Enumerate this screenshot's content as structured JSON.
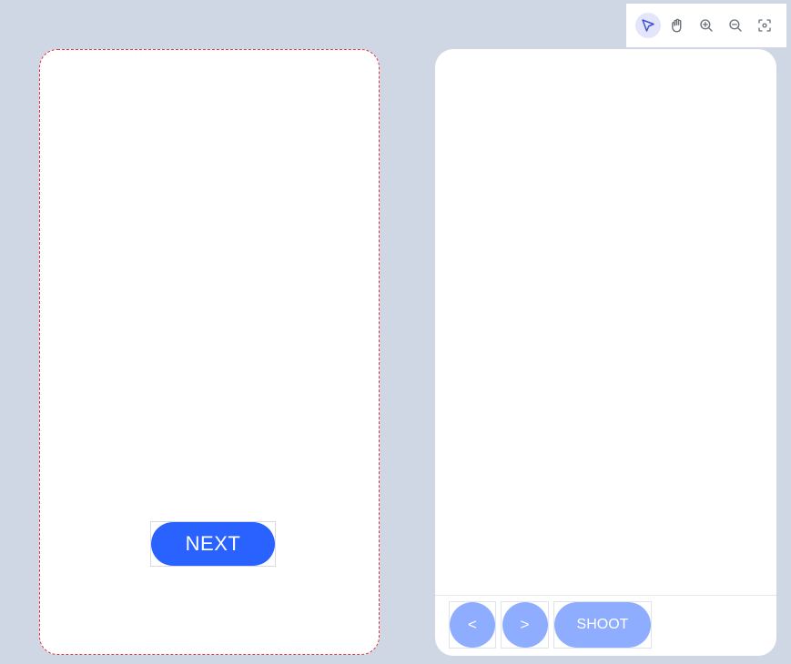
{
  "toolbar": {
    "tools": [
      {
        "icon": "pointer-icon",
        "active": true
      },
      {
        "icon": "hand-icon",
        "active": false
      },
      {
        "icon": "zoom-in-icon",
        "active": false
      },
      {
        "icon": "zoom-out-icon",
        "active": false
      },
      {
        "icon": "fit-screen-icon",
        "active": false
      }
    ],
    "accent": "#3f51d6"
  },
  "left_screen": {
    "next_label": "NEXT",
    "button_color": "#2962ff"
  },
  "right_screen": {
    "prev_label": "<",
    "next_label": ">",
    "shoot_label": "SHOOT",
    "button_color": "#8fadff"
  },
  "colors": {
    "background": "#cfd6e4",
    "selection_border": "#e0343c"
  }
}
